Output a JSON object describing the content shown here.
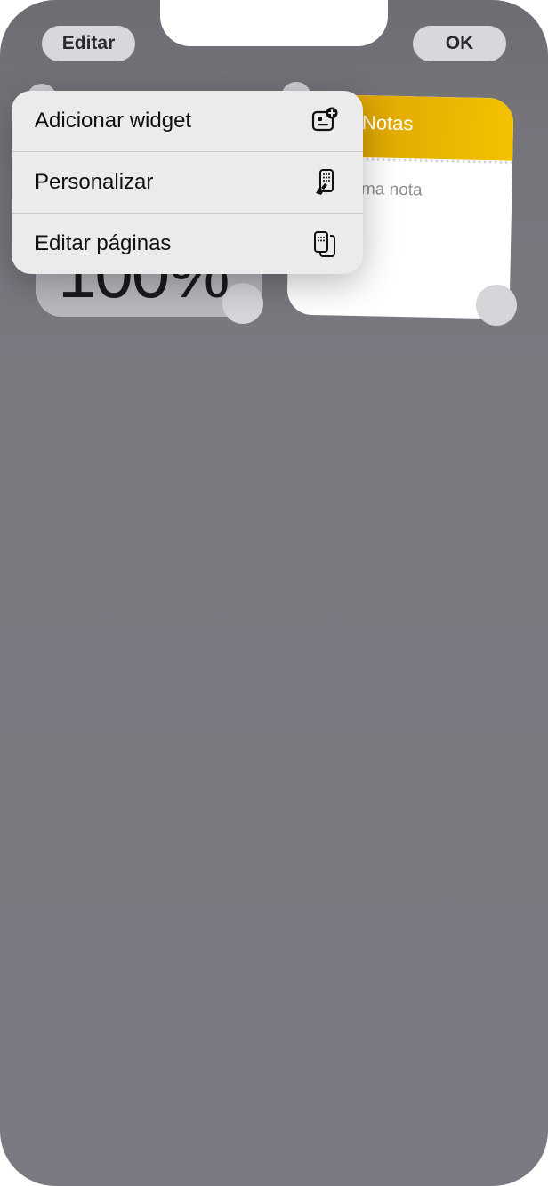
{
  "topbar": {
    "edit_label": "Editar",
    "done_label": "OK"
  },
  "widgets": {
    "battery_value": "100%",
    "notes_title": "Notas",
    "notes_placeholder": "uma nota"
  },
  "menu": {
    "items": [
      {
        "label": "Adicionar widget",
        "icon": "widget-add-icon"
      },
      {
        "label": "Personalizar",
        "icon": "paintbrush-phone-icon"
      },
      {
        "label": "Editar páginas",
        "icon": "pages-icon"
      }
    ]
  }
}
